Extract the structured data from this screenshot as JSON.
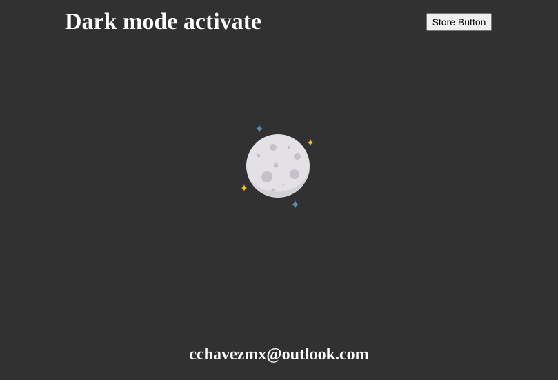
{
  "header": {
    "title": "Dark mode activate",
    "store_button_label": "Store Button"
  },
  "illustration": {
    "icon": "moon-with-sparkles-icon",
    "colors": {
      "moon": "#e3e1e6",
      "crater": "#c4c2c8",
      "sparkle_blue": "#5a8db3",
      "sparkle_yellow": "#f5c81f"
    }
  },
  "footer": {
    "email": "cchavezmx@outlook.com"
  },
  "theme": {
    "background": "#313131",
    "text": "#ffffff"
  }
}
